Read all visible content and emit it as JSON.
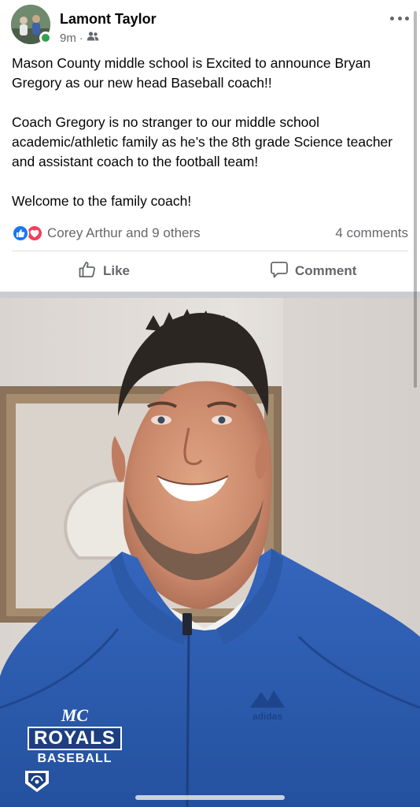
{
  "post": {
    "author_name": "Lamont Taylor",
    "time": "9m",
    "separator": "·",
    "audience_icon": "friends-icon",
    "paragraphs": [
      "Mason County middle school is Excited to announce Bryan Gregory as our new head Baseball coach!!",
      "Coach Gregory is no stranger to our middle school academic/athletic family as he’s the 8th grade Science teacher and assistant coach to the football team!",
      "Welcome to the family coach!"
    ],
    "reactions": [
      "like-reaction-icon",
      "love-reaction-icon"
    ],
    "reactors_text": "Corey Arthur and 9 others",
    "comments_text": "4 comments"
  },
  "actions": {
    "like_label": "Like",
    "comment_label": "Comment"
  },
  "photo": {
    "logo_initials": "MC",
    "logo_team": "ROYALS",
    "logo_sport": "BASEBALL"
  },
  "colors": {
    "accent_like": "#1877f2",
    "accent_love": "#f33e58",
    "online": "#31a24c",
    "secondary_text": "#65676b",
    "jacket": "#2a5bb0"
  }
}
